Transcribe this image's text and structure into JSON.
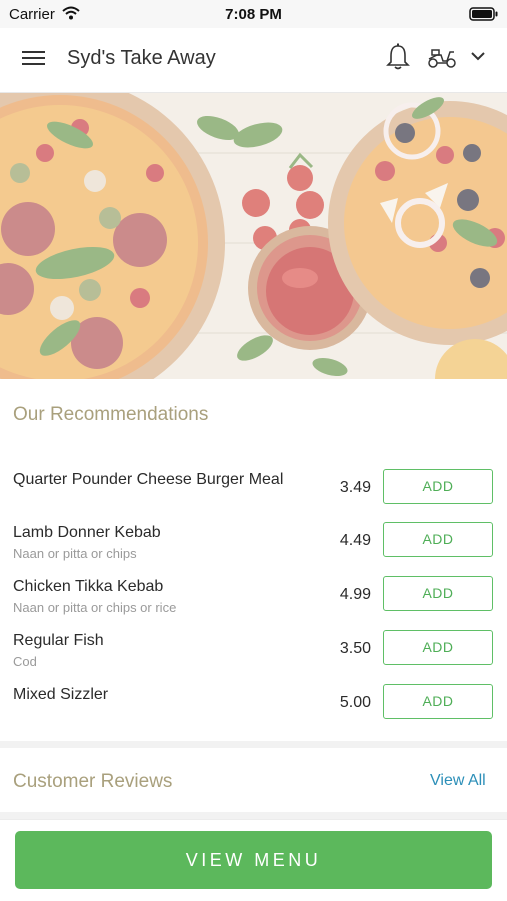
{
  "status_bar": {
    "carrier": "Carrier",
    "time": "7:08 PM"
  },
  "header": {
    "title": "Syd's Take Away"
  },
  "recommendations": {
    "title": "Our Recommendations",
    "items": [
      {
        "name": "Quarter Pounder Cheese Burger Meal",
        "description": "",
        "price": "3.49",
        "button": "ADD"
      },
      {
        "name": "Lamb Donner Kebab",
        "description": "Naan or pitta or chips",
        "price": "4.49",
        "button": "ADD"
      },
      {
        "name": "Chicken Tikka Kebab",
        "description": "Naan or pitta or chips or rice",
        "price": "4.99",
        "button": "ADD"
      },
      {
        "name": "Regular Fish",
        "description": "Cod",
        "price": "3.50",
        "button": "ADD"
      },
      {
        "name": "Mixed Sizzler",
        "description": "",
        "price": "5.00",
        "button": "ADD"
      }
    ]
  },
  "reviews": {
    "title": "Customer Reviews",
    "view_all": "View All"
  },
  "footer": {
    "button": "VIEW MENU"
  },
  "colors": {
    "accent_green": "#5cb85c",
    "link_blue": "#2c8fb8",
    "section_title": "#a9a07d"
  },
  "icons": [
    "menu-icon",
    "bell-icon",
    "scooter-icon",
    "chevron-down-icon",
    "wifi-icon",
    "battery-icon"
  ]
}
